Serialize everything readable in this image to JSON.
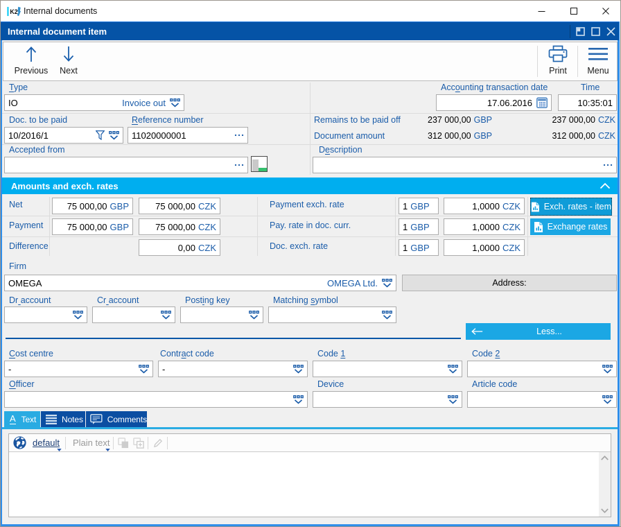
{
  "app": {
    "title": "Internal documents",
    "icon_text": "K2"
  },
  "doc_window": {
    "title": "Internal document item"
  },
  "toolbar": {
    "previous": "Previous",
    "next": "Next",
    "print": "Print",
    "menu": "Menu"
  },
  "form": {
    "type": {
      "label": "&Type",
      "code": "IO",
      "name": "Invoice out"
    },
    "acc_date": {
      "label": "Acc&ounting transaction date",
      "value": "17.06.2016"
    },
    "time": {
      "label": "Time",
      "value": "10:35:01"
    },
    "doc_to_pay": {
      "label": "Doc. to be paid",
      "value": "10/2016/1"
    },
    "reference": {
      "label": "&Reference number",
      "value": "11020000001"
    },
    "remains": {
      "label": "Remains to be paid off",
      "gbp": "237 000,00",
      "gbp_cur": "GBP",
      "czk": "237 000,00",
      "czk_cur": "CZK"
    },
    "doc_amount": {
      "label": "Document amount",
      "gbp": "312 000,00",
      "gbp_cur": "GBP",
      "czk": "312 000,00",
      "czk_cur": "CZK"
    },
    "accepted": {
      "label": "Accepted from",
      "value": ""
    },
    "description": {
      "label": "D&escription",
      "value": ""
    }
  },
  "amounts": {
    "header": "Amounts and exch. rates",
    "net": {
      "label": "Net",
      "gbp": "75 000,00",
      "gbp_cur": "GBP",
      "czk": "75 000,00",
      "czk_cur": "CZK"
    },
    "payment": {
      "label": "Payment",
      "gbp": "75 000,00",
      "gbp_cur": "GBP",
      "czk": "75 000,00",
      "czk_cur": "CZK"
    },
    "difference": {
      "label": "Difference",
      "czk": "0,00",
      "czk_cur": "CZK"
    },
    "payment_rate": {
      "label": "Payment exch. rate",
      "unit": "1",
      "unit_cur": "GBP",
      "rate": "1,0000",
      "rate_cur": "CZK"
    },
    "pay_rate_doc": {
      "label": "Pay. rate in doc. curr.",
      "unit": "1",
      "unit_cur": "GBP",
      "rate": "1,0000",
      "rate_cur": "CZK"
    },
    "doc_rate": {
      "label": "Doc. exch. rate",
      "unit": "1",
      "unit_cur": "GBP",
      "rate": "1,0000",
      "rate_cur": "CZK"
    },
    "btn_exch_item": "Exch. rates - item",
    "btn_exch": "Exchange rates"
  },
  "firm": {
    "label": "Firm",
    "code": "OMEGA",
    "name": "OMEGA Ltd.",
    "address_label": "Address:"
  },
  "accounts": {
    "dr": {
      "label": "Dr& account"
    },
    "cr": {
      "label": "Cr& account"
    },
    "posting": {
      "label": "Post&ing key"
    },
    "matching": {
      "label": "Matching &symbol"
    }
  },
  "less_button": "Less...",
  "codes": {
    "cost_centre": {
      "label": "&Cost centre",
      "value": "-"
    },
    "contract": {
      "label": "Contr&act code",
      "value": "-"
    },
    "code1": {
      "label": "Code &1",
      "value": ""
    },
    "code2": {
      "label": "Code &2",
      "value": ""
    },
    "officer": {
      "label": "&Officer",
      "value": ""
    },
    "device": {
      "label": "Device",
      "value": ""
    },
    "article": {
      "label": "Article code",
      "value": ""
    }
  },
  "tabs": {
    "text": "Text",
    "text_icon_glyph": "A",
    "notes": "Notes",
    "comments": "Comments"
  },
  "editor": {
    "language": "default",
    "format": "Plain text"
  }
}
